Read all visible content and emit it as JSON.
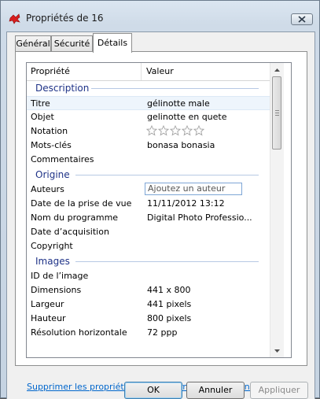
{
  "window": {
    "title": "Propriétés de 16"
  },
  "tabs": [
    {
      "label": "Général"
    },
    {
      "label": "Sécurité"
    },
    {
      "label": "Détails"
    }
  ],
  "grid": {
    "headers": {
      "property": "Propriété",
      "value": "Valeur"
    },
    "groups": {
      "description": "Description",
      "origin": "Origine",
      "images": "Images"
    },
    "description": [
      {
        "key": "Titre",
        "value": "gélinotte male"
      },
      {
        "key": "Objet",
        "value": "gelinotte en quete"
      },
      {
        "key": "Notation",
        "value": "",
        "rating_stars": 0
      },
      {
        "key": "Mots-clés",
        "value": "bonasa bonasia"
      },
      {
        "key": "Commentaires",
        "value": ""
      }
    ],
    "origin": [
      {
        "key": "Auteurs",
        "value": "Ajoutez un auteur"
      },
      {
        "key": "Date de la prise de vue",
        "value": "11/11/2012 13:12"
      },
      {
        "key": "Nom du programme",
        "value": "Digital Photo Professio..."
      },
      {
        "key": "Date d’acquisition",
        "value": ""
      },
      {
        "key": "Copyright",
        "value": ""
      }
    ],
    "images": [
      {
        "key": "ID de l’image",
        "value": ""
      },
      {
        "key": "Dimensions",
        "value": "441 x 800"
      },
      {
        "key": "Largeur",
        "value": "441 pixels"
      },
      {
        "key": "Hauteur",
        "value": "800 pixels"
      },
      {
        "key": "Résolution horizontale",
        "value": "72 ppp"
      }
    ]
  },
  "remove_link": "Supprimer les propriétés et les informations personnelles",
  "buttons": {
    "ok": "OK",
    "cancel": "Annuler",
    "apply": "Appliquer"
  },
  "colors": {
    "group_text": "#1e3287",
    "link": "#0066cc",
    "selection": "#eef5fc"
  }
}
